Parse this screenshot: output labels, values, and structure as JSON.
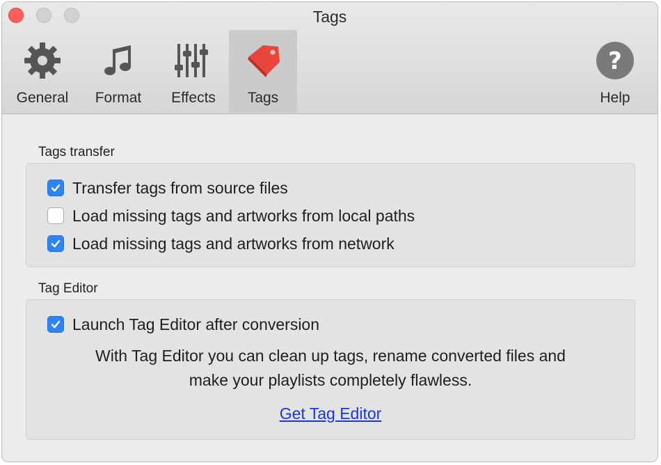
{
  "window": {
    "title": "Tags"
  },
  "toolbar": {
    "items": [
      {
        "label": "General",
        "icon": "gear-icon"
      },
      {
        "label": "Format",
        "icon": "music-note-icon"
      },
      {
        "label": "Effects",
        "icon": "sliders-icon"
      },
      {
        "label": "Tags",
        "icon": "tag-icon",
        "active": true
      },
      {
        "label": "Help",
        "icon": "help-icon"
      }
    ]
  },
  "tags_transfer": {
    "title": "Tags transfer",
    "options": [
      {
        "label": "Transfer tags from source files",
        "checked": true
      },
      {
        "label": "Load missing tags and artworks from local paths",
        "checked": false
      },
      {
        "label": "Load missing tags and artworks from network",
        "checked": true
      }
    ]
  },
  "tag_editor": {
    "title": "Tag Editor",
    "launch_label": "Launch Tag Editor after conversion",
    "launch_checked": true,
    "description_line1": "With Tag Editor you can clean up tags, rename converted files and",
    "description_line2": "make your playlists completely flawless.",
    "link_label": "Get Tag Editor"
  },
  "colors": {
    "checkbox_on": "#2f83f5",
    "link": "#1a36d6",
    "close_button": "#fc5f57",
    "tags_icon": "#e8453c"
  }
}
